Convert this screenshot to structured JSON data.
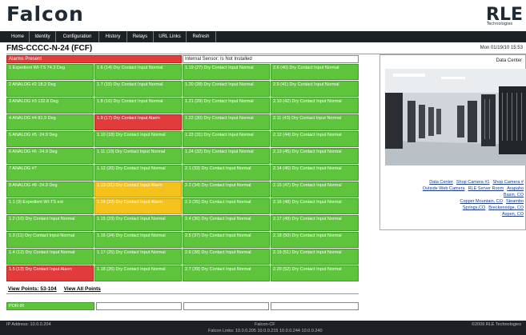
{
  "header": {
    "logo": "Falcon",
    "logo_right": "RLE",
    "logo_right_sub": "Technologies"
  },
  "nav": [
    "Home",
    "Identity",
    "Configuration",
    "History",
    "Relays",
    "URL Links",
    "Refresh"
  ],
  "title": "FMS-CCCC-N-24 (FCF)",
  "datetime": "Mon 01/19/10 15:53",
  "alarm_banner": "Alarms Present",
  "sensor_banner": "Internal Sensor: Is Not Installed",
  "grid": [
    [
      {
        "t": "1 Expedient WI-TS 74.3 Deg",
        "s": "g"
      },
      {
        "t": "1.6   (14) Dry Contact Input Normal",
        "s": "g"
      },
      {
        "t": "1.19 (27) Dry Contact Input Normal",
        "s": "g"
      },
      {
        "t": "2.6   (40) Dry Contact Input Normal",
        "s": "g"
      }
    ],
    [
      {
        "t": "2 ANALOG #2 18.2 Deg",
        "s": "g"
      },
      {
        "t": "1.7   (15) Dry Contact Input Normal",
        "s": "g"
      },
      {
        "t": "1.20 (28) Dry Contact Input Normal",
        "s": "g"
      },
      {
        "t": "2.9   (41) Dry Contact Input Normal",
        "s": "g"
      }
    ],
    [
      {
        "t": "3 ANALOG #3 132.8 Deg",
        "s": "g"
      },
      {
        "t": "1.8   (16) Dry Contact Input Normal",
        "s": "g"
      },
      {
        "t": "1.21 (29) Dry Contact Input Normal",
        "s": "g"
      },
      {
        "t": "2.10 (42) Dry Contact Input Normal",
        "s": "g"
      }
    ],
    [
      {
        "t": "4 ANALOG #4 81.9 Deg",
        "s": "g"
      },
      {
        "t": "1.9   (17) Dry Contact Input Alarm",
        "s": "r"
      },
      {
        "t": "1.22 (30) Dry Contact Input Normal",
        "s": "g"
      },
      {
        "t": "2.11 (43) Dry Contact Input Normal",
        "s": "g"
      }
    ],
    [
      {
        "t": "5 ANALOG #5 -24.9 Deg",
        "s": "g"
      },
      {
        "t": "1.10 (18) Dry Contact Input Normal",
        "s": "g"
      },
      {
        "t": "1.23 (31) Dry Contact Input Normal",
        "s": "g"
      },
      {
        "t": "2.12 (44) Dry Contact Input Normal",
        "s": "g"
      }
    ],
    [
      {
        "t": "6 ANALOG #6 -24.9 Deg",
        "s": "g"
      },
      {
        "t": "1.11 (19) Dry Contact Input Normal",
        "s": "g"
      },
      {
        "t": "1.24 (32) Dry Contact Input Normal",
        "s": "g"
      },
      {
        "t": "2.13 (45) Dry Contact Input Normal",
        "s": "g"
      }
    ],
    [
      {
        "t": "7 ANALOG #7",
        "s": "g"
      },
      {
        "t": "1.12 (20) Dry Contact Input Normal",
        "s": "g"
      },
      {
        "t": "2.1   (33) Dry Contact Input Normal",
        "s": "g"
      },
      {
        "t": "2.14 (46) Dry Contact Input Normal",
        "s": "g"
      }
    ],
    [
      {
        "t": "8 ANALOG #8 -24.9 Deg",
        "s": "g"
      },
      {
        "t": "1.13 (21) Dry Contact Input Alarm",
        "s": "y"
      },
      {
        "t": "2.2   (34) Dry Contact Input Normal",
        "s": "g"
      },
      {
        "t": "2.15 (47) Dry Contact Input Normal",
        "s": "g"
      }
    ],
    [
      {
        "t": "1.1   (9) Expedient WI-TS ext",
        "s": "g"
      },
      {
        "t": "1.14 (22) Dry Contact Input Alarm",
        "s": "y"
      },
      {
        "t": "2.3   (35) Dry Contact Input Normal",
        "s": "g"
      },
      {
        "t": "2.16 (48) Dry Contact Input Normal",
        "s": "g"
      }
    ],
    [
      {
        "t": "1.2   (10) Dry Contact Input Normal",
        "s": "g"
      },
      {
        "t": "1.15 (23) Dry Contact Input Normal",
        "s": "g"
      },
      {
        "t": "2.4   (36) Dry Contact Input Normal",
        "s": "g"
      },
      {
        "t": "2.17 (49) Dry Contact Input Normal",
        "s": "g"
      }
    ],
    [
      {
        "t": "1.3   (11) Dry Contact Input Normal",
        "s": "g"
      },
      {
        "t": "1.16 (24) Dry Contact Input Normal",
        "s": "g"
      },
      {
        "t": "2.5   (37) Dry Contact Input Normal",
        "s": "g"
      },
      {
        "t": "2.18 (50) Dry Contact Input Normal",
        "s": "g"
      }
    ],
    [
      {
        "t": "1.4   (12) Dry Contact Input Normal",
        "s": "g"
      },
      {
        "t": "1.17 (25) Dry Contact Input Normal",
        "s": "g"
      },
      {
        "t": "2.6   (38) Dry Contact Input Normal",
        "s": "g"
      },
      {
        "t": "2.19 (51) Dry Contact Input Normal",
        "s": "g"
      }
    ],
    [
      {
        "t": "1.5   (13) Dry Contact Input Alarm",
        "s": "r"
      },
      {
        "t": "1.18 (26) Dry Contact Input Normal",
        "s": "g"
      },
      {
        "t": "2.7   (39) Dry Contact Input Normal",
        "s": "g"
      },
      {
        "t": "2.20 (52) Dry Contact Input Normal",
        "s": "g"
      }
    ]
  ],
  "view_points": "View Points:  53-104",
  "view_all": "View All Points",
  "por_label": "POR-IR",
  "camera": {
    "title": "Data Center",
    "links": [
      "Data Center",
      "Shop Camera #1",
      "Shop Camera #",
      "Outside Web Camera",
      "RLE Server Room",
      "Arapaho",
      "Basin, CO",
      "Copper Mountain, CO",
      "Steambo",
      "Springs,CO",
      "Breckenridge, CO",
      "Aspen, CO"
    ]
  },
  "footer": {
    "ip": "IP Address: 10.0.0.204",
    "center": "Falcon-CF",
    "links": "Falcon Links:  10.0.0.205   10.0.0.215   10.0.0.244   10.0.0.240",
    "copyright": "©2009 RLE Technologies"
  },
  "colors": {
    "normal": "#5ec43b",
    "alarm": "#e23b3b",
    "warning": "#f4c21b",
    "nav": "#1d2126"
  }
}
